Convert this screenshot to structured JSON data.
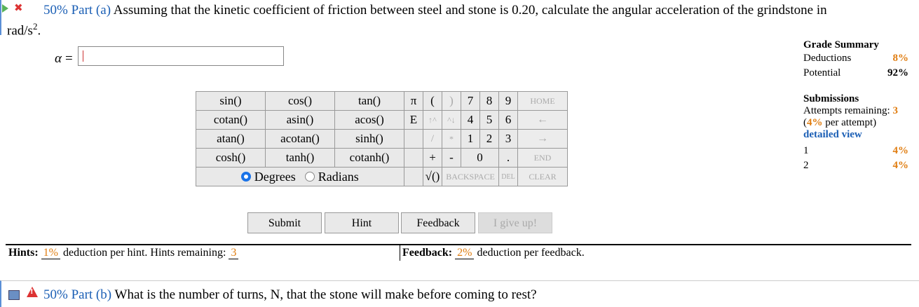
{
  "part_a": {
    "pct": "50%",
    "part": "Part (a)",
    "question_line1": "Assuming that the kinetic coefficient of friction between steel and stone is 0.20, calculate the angular acceleration of the grindstone in",
    "question_line2": "rad/s",
    "question_sup": "2",
    "question_end": "."
  },
  "answer": {
    "label": "α",
    "eq": "=",
    "value": ""
  },
  "keypad": {
    "functions": [
      [
        "sin()",
        "cos()",
        "tan()"
      ],
      [
        "cotan()",
        "asin()",
        "acos()"
      ],
      [
        "atan()",
        "acotan()",
        "sinh()"
      ],
      [
        "cosh()",
        "tanh()",
        "cotanh()"
      ]
    ],
    "pi": "π",
    "e": "E",
    "lparen": "(",
    "rparen": ")",
    "up1": "↑^",
    "up2": "^↓",
    "slash": "/",
    "star": "*",
    "plus": "+",
    "minus": "-",
    "sqrt": "√()",
    "digits": [
      [
        "7",
        "8",
        "9"
      ],
      [
        "4",
        "5",
        "6"
      ],
      [
        "1",
        "2",
        "3"
      ]
    ],
    "zero": "0",
    "dot": ".",
    "home": "HOME",
    "left": "←",
    "right": "→",
    "end": "END",
    "backspace": "BACKSPACE",
    "del": "DEL",
    "clear": "CLEAR",
    "degrees": "Degrees",
    "radians": "Radians"
  },
  "buttons": {
    "submit": "Submit",
    "hint": "Hint",
    "feedback": "Feedback",
    "give_up": "I give up!"
  },
  "hints": {
    "label": "Hints:",
    "pct": "1%",
    "text": "deduction per hint. Hints remaining:",
    "remaining": "3"
  },
  "feedback": {
    "label": "Feedback:",
    "pct": "2%",
    "text": "deduction per feedback."
  },
  "part_b": {
    "pct": "50%",
    "part": "Part (b)",
    "question": "What is the number of turns, N, that the stone will make before coming to rest?"
  },
  "grade_summary": {
    "title": "Grade Summary",
    "deductions_label": "Deductions",
    "deductions": "8%",
    "potential_label": "Potential",
    "potential": "92%"
  },
  "submissions": {
    "title": "Submissions",
    "attempts_label": "Attempts remaining:",
    "attempts": "3",
    "per_pct": "4%",
    "per_text": "per attempt)",
    "detailed": "detailed view",
    "rows": [
      {
        "n": "1",
        "pct": "4%"
      },
      {
        "n": "2",
        "pct": "4%"
      }
    ]
  },
  "colors": {
    "accent_blue": "#1b5fb5",
    "orange": "#e07d10",
    "error_red": "#dd3333",
    "status_green": "#58b25a"
  }
}
